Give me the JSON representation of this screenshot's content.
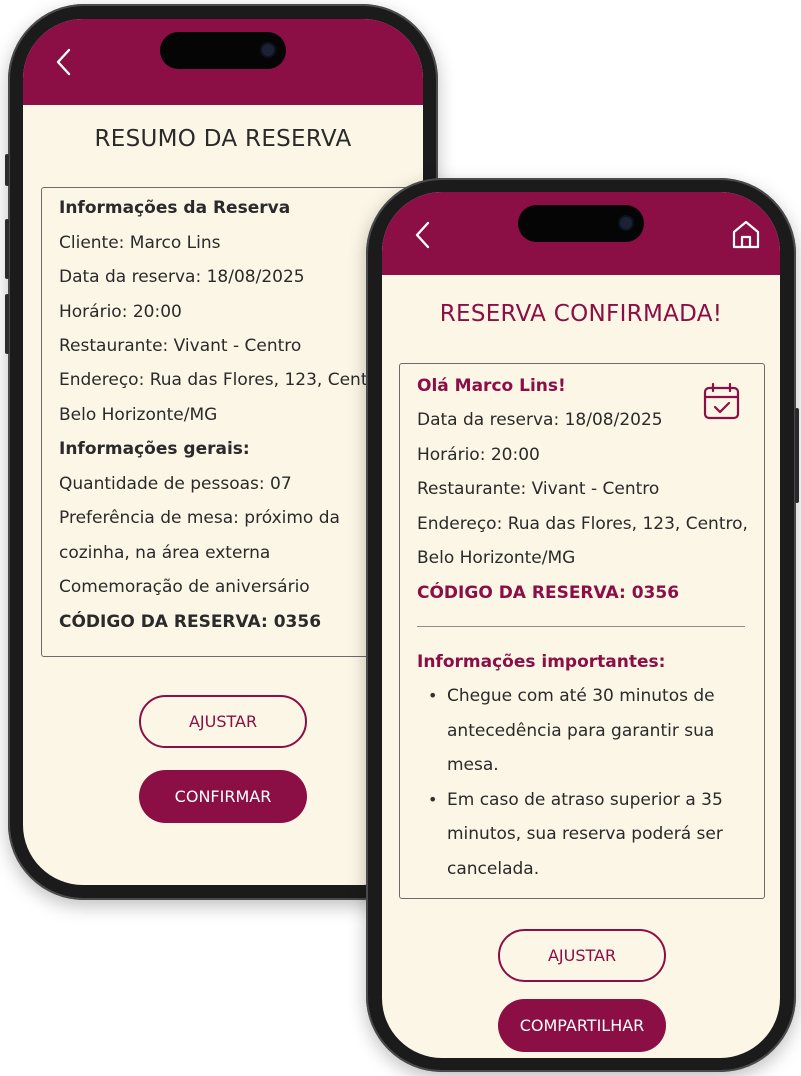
{
  "colors": {
    "brand": "#8b0e45",
    "background": "#fcf6e6",
    "frame": "#1b1b1c"
  },
  "summary_screen": {
    "title": "RESUMO DA RESERVA",
    "back_icon": "chevron-left-icon",
    "card": {
      "section1_heading": "Informações da Reserva",
      "client": "Cliente: Marco Lins",
      "date": "Data da reserva: 18/08/2025",
      "time": "Horário: 20:00",
      "restaurant": "Restaurante: Vivant - Centro",
      "address_line1": "Endereço: Rua das Flores, 123, Centro",
      "address_line2": "Belo Horizonte/MG",
      "section2_heading": "Informações gerais:",
      "people": "Quantidade de pessoas: 07",
      "table_pref_line1": "Preferência de mesa: próximo da",
      "table_pref_line2": "cozinha, na área externa",
      "celebration": "Comemoração de aniversário",
      "code": "CÓDIGO DA RESERVA: 0356"
    },
    "adjust_label": "AJUSTAR",
    "confirm_label": "CONFIRMAR"
  },
  "confirmed_screen": {
    "title": "RESERVA CONFIRMADA!",
    "back_icon": "chevron-left-icon",
    "home_icon": "home-icon",
    "card": {
      "greeting": "Olá Marco Lins!",
      "calendar_icon": "calendar-check-icon",
      "date": "Data da reserva: 18/08/2025",
      "time": "Horário: 20:00",
      "restaurant": "Restaurante: Vivant - Centro",
      "address_line1": "Endereço: Rua das Flores, 123, Centro,",
      "address_line2": "Belo Horizonte/MG",
      "code": "CÓDIGO DA RESERVA: 0356",
      "important_heading": "Informações importantes:",
      "tip1_line1": "Chegue com até 30 minutos de",
      "tip1_line2": "antecedência para garantir sua",
      "tip1_line3": "mesa.",
      "tip2_line1": "Em caso de atraso superior a 35",
      "tip2_line2": "minutos, sua reserva poderá ser",
      "tip2_line3": "cancelada."
    },
    "adjust_label": "AJUSTAR",
    "share_label": "COMPARTILHAR"
  }
}
